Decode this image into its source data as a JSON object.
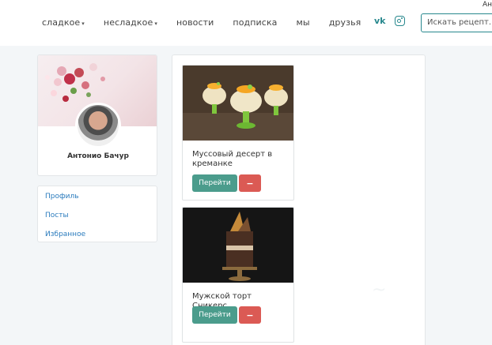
{
  "header": {
    "user_corner": "Ан",
    "nav": [
      {
        "label": "сладкое",
        "has_caret": true
      },
      {
        "label": "несладкое",
        "has_caret": true
      },
      {
        "label": "новости",
        "has_caret": false
      },
      {
        "label": "подписка",
        "has_caret": false
      },
      {
        "label": "мы",
        "has_caret": false
      },
      {
        "label": "друзья",
        "has_caret": false
      }
    ],
    "caret": "▾",
    "vk_label": "vk",
    "search_placeholder": "Искать рецепт..."
  },
  "profile": {
    "name": "Антонио Бачур"
  },
  "menu": [
    {
      "label": "Профиль"
    },
    {
      "label": "Посты"
    },
    {
      "label": "Избранное"
    }
  ],
  "recipes": [
    {
      "title": "Муссовый десерт в креманке",
      "go_label": "Перейти",
      "remove_label": "−"
    },
    {
      "title": "Мужской торт Сникерс",
      "go_label": "Перейти",
      "remove_label": "−"
    }
  ],
  "colors": {
    "accent": "#28888e",
    "go_button": "#4b9c8c",
    "remove_button": "#db5a54",
    "link": "#2a7bbd",
    "background": "#f3f6f8"
  },
  "icons": {
    "social": [
      "vk-icon",
      "instagram-icon"
    ]
  }
}
